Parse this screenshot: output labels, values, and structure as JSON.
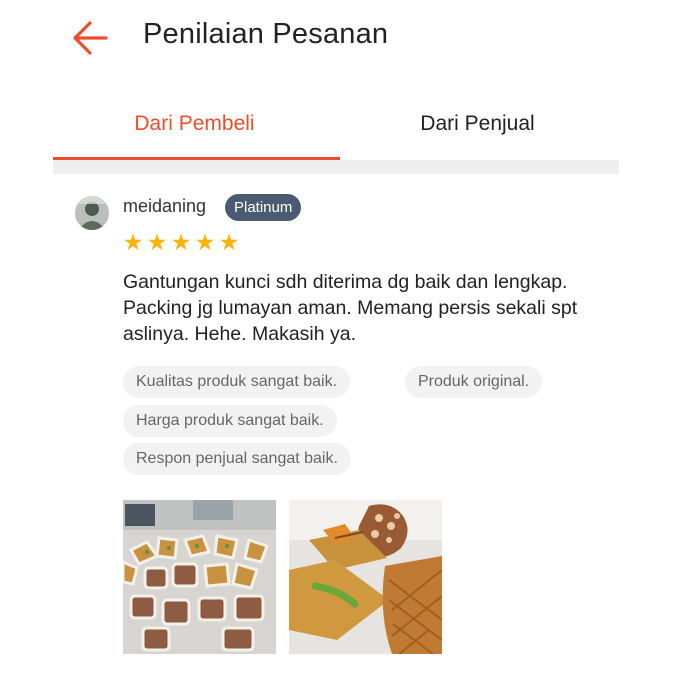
{
  "header": {
    "back_icon": "arrow-left-icon",
    "title": "Penilaian Pesanan"
  },
  "accent_color": "#ee4d2d",
  "tabs": [
    {
      "label": "Dari Pembeli",
      "active": true
    },
    {
      "label": "Dari Penjual",
      "active": false
    }
  ],
  "review": {
    "username": "meidaning",
    "badge": "Platinum",
    "rating": 5,
    "star_icon": "star-icon",
    "star_color": "#fbb20d",
    "text": "Gantungan kunci sdh diterima dg baik dan lengkap. Packing jg lumayan aman. Memang persis sekali spt aslinya. Hehe. Makasih ya.",
    "tags": [
      "Kualitas produk sangat baik.",
      "Produk original.",
      "Harga produk sangat baik.",
      "Respon penjual sangat baik."
    ],
    "photos": [
      "review-photo",
      "review-photo"
    ]
  }
}
